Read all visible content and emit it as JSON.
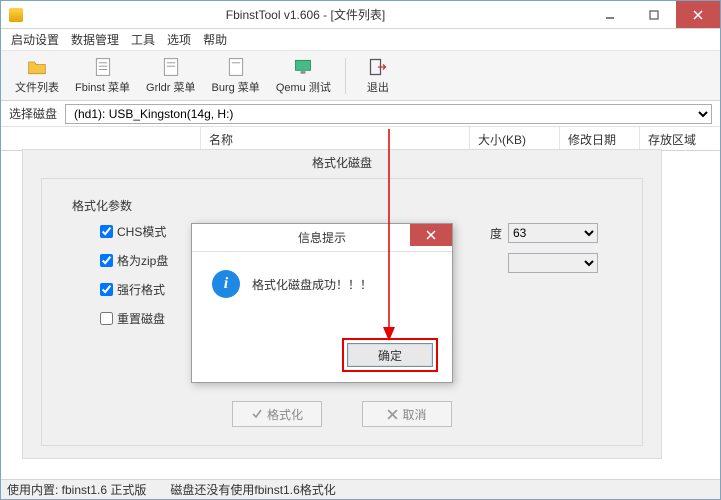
{
  "window": {
    "title": "FbinstTool v1.606 - [文件列表]"
  },
  "menu": {
    "items": [
      "启动设置",
      "数据管理",
      "工具",
      "选项",
      "帮助"
    ]
  },
  "toolbar": {
    "file_list": "文件列表",
    "fbinst_menu": "Fbinst 菜单",
    "grldr_menu": "Grldr 菜单",
    "burg_menu": "Burg 菜单",
    "qemu_test": "Qemu 测试",
    "exit": "退出"
  },
  "disk": {
    "label": "选择磁盘",
    "selected": "(hd1): USB_Kingston(14g, H:)"
  },
  "columns": {
    "name": "名称",
    "size": "大小(KB)",
    "date": "修改日期",
    "area": "存放区域"
  },
  "format_dialog": {
    "title": "格式化磁盘",
    "params_label": "格式化参数",
    "chk_chs": "CHS模式",
    "chk_zip": "格为zip盘",
    "chk_force": "强行格式",
    "chk_reset": "重置磁盘",
    "speed_suffix": "度",
    "speed_value": "63",
    "btn_format": "格式化",
    "btn_cancel": "取消"
  },
  "msgbox": {
    "title": "信息提示",
    "message": "格式化磁盘成功！！！",
    "ok": "确定"
  },
  "status": {
    "left": "使用内置: fbinst1.6 正式版",
    "right": "磁盘还没有使用fbinst1.6格式化"
  }
}
